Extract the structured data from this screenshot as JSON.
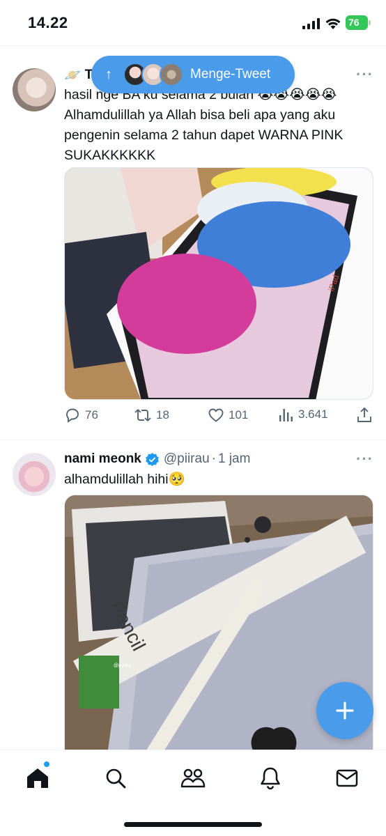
{
  "status_bar": {
    "time": "14.22",
    "battery": "76"
  },
  "new_tweets_pill": {
    "label": "Menge-Tweet"
  },
  "tweets": [
    {
      "name_partial": "T",
      "text": "hasil nge BA ku selama 2 bulan 😭😭😭😭😭 Alhamdulillah ya Allah bisa beli apa yang aku pengenin selama 2 tahun dapet WARNA PINK SUKAKKKKKK",
      "actions": {
        "replies": "76",
        "retweets": "18",
        "likes": "101",
        "views": "3.641"
      }
    },
    {
      "name": "nami meonk",
      "handle": "@piirau",
      "time": "1 jam",
      "text": "alhamdulillah hihi🥺",
      "media_watermark": "@piirau",
      "product_label": "Pencil"
    }
  ],
  "icons": {
    "reply": "reply-icon",
    "retweet": "retweet-icon",
    "like": "heart-icon",
    "views": "views-icon",
    "share": "share-icon",
    "compose": "plus-icon",
    "home": "home-icon",
    "search": "search-icon",
    "communities": "communities-icon",
    "notifications": "bell-icon",
    "messages": "envelope-icon"
  },
  "colors": {
    "accent": "#1d9bf0",
    "pill": "#4a9be9",
    "battery": "#34c759",
    "verified": "#1d9bf0"
  }
}
